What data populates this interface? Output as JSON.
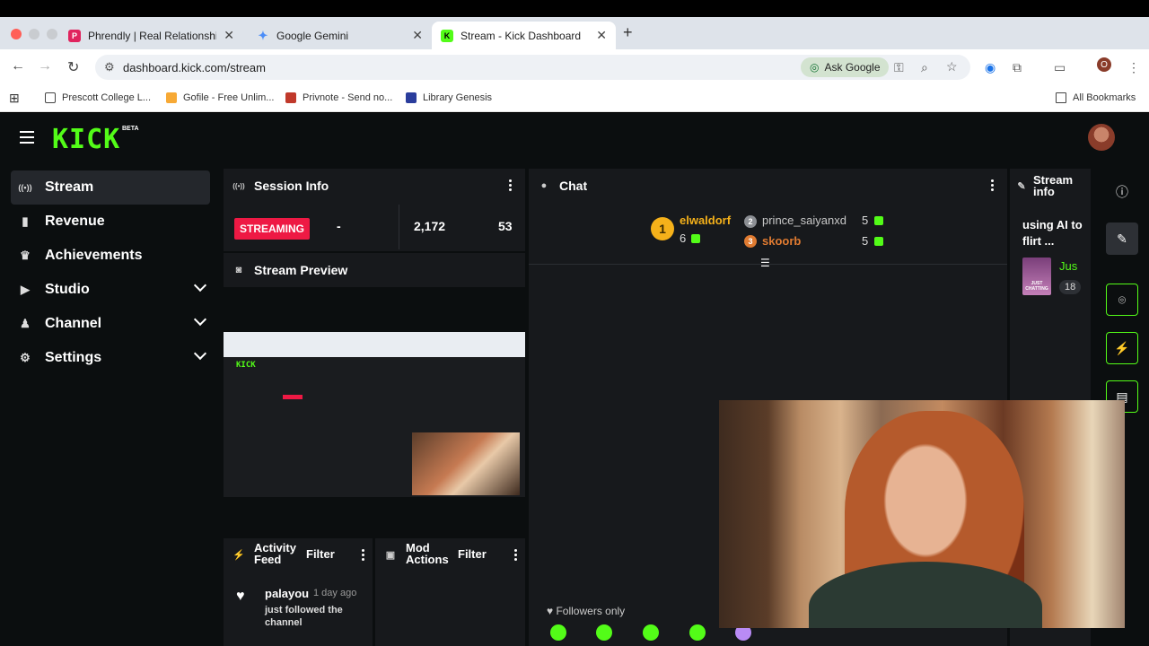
{
  "browser": {
    "tabs": [
      {
        "title": "Phrendly | Real Relationships",
        "color": "#e0245e",
        "glyph": "P"
      },
      {
        "title": "Google Gemini",
        "color": "#4b8df8",
        "glyph": "✦"
      },
      {
        "title": "Stream - Kick Dashboard",
        "color": "#53fc18",
        "glyph": "K"
      }
    ],
    "url": "dashboard.kick.com/stream",
    "ask_google": "Ask Google",
    "profile_initial": "O",
    "bookmarks": [
      {
        "label": "Prescott College L...",
        "color": "#444"
      },
      {
        "label": "Gofile - Free Unlim...",
        "color": "#f7a935"
      },
      {
        "label": "Privnote - Send no...",
        "color": "#c0392b"
      },
      {
        "label": "Library Genesis",
        "color": "#2a3d9c"
      }
    ],
    "all_bookmarks": "All Bookmarks"
  },
  "kick": {
    "logo": "KICK",
    "beta": "BETA",
    "nav": [
      {
        "label": "Stream",
        "icon": "((•))",
        "active": true,
        "expandable": false
      },
      {
        "label": "Revenue",
        "icon": "▮",
        "active": false,
        "expandable": false
      },
      {
        "label": "Achievements",
        "icon": "🏆",
        "active": false,
        "expandable": false
      },
      {
        "label": "Studio",
        "icon": "▶",
        "active": false,
        "expandable": true
      },
      {
        "label": "Channel",
        "icon": "♟",
        "active": false,
        "expandable": true
      },
      {
        "label": "Settings",
        "icon": "⚙",
        "active": false,
        "expandable": true
      }
    ],
    "session": {
      "title": "Session Info",
      "status": "STREAMING",
      "uptime": "-",
      "followers": "2,172",
      "subs": "53"
    },
    "preview": {
      "title": "Stream Preview"
    },
    "chat": {
      "title": "Chat",
      "top": [
        {
          "rank": "1",
          "name": "elwaldorf",
          "count": "6",
          "color": "#f5b11a"
        },
        {
          "rank": "2",
          "name": "prince_saiyanxd",
          "count": "5",
          "color": "#c8c8c8"
        },
        {
          "rank": "3",
          "name": "skoorb",
          "count": "5",
          "color": "#e07b31"
        }
      ],
      "followers_only": "Followers only"
    },
    "stream_info": {
      "title": "Stream info",
      "stream_title": "using AI to flirt ...",
      "category": "Jus",
      "viewers": "18",
      "thumb_label": "JUST CHATTING"
    },
    "activity": {
      "title": "Activity Feed",
      "filter": "Filter",
      "user": "palayou",
      "time": "1 day ago",
      "event": "just followed the channel"
    },
    "mod": {
      "title": "Mod Actions",
      "filter": "Filter"
    }
  }
}
